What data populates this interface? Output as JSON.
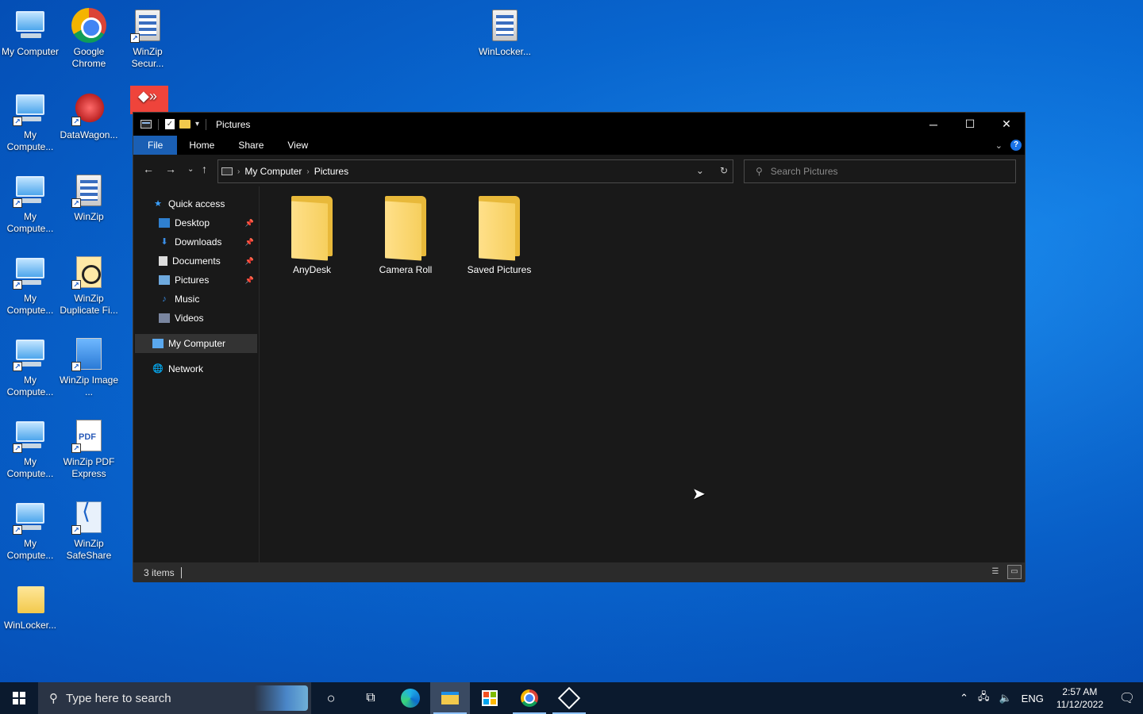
{
  "desktop": {
    "icons": [
      {
        "label": "My Computer",
        "type": "pc"
      },
      {
        "label": "Google Chrome",
        "type": "chrome"
      },
      {
        "label": "WinZip Secur...",
        "type": "zip"
      },
      {
        "label": "WinLocker...",
        "type": "zip"
      },
      {
        "label": "My Compute...",
        "type": "pc"
      },
      {
        "label": "DataWagon...",
        "type": "data"
      },
      {
        "label": "My Compute...",
        "type": "pc"
      },
      {
        "label": "WinZip",
        "type": "zip"
      },
      {
        "label": "My Compute...",
        "type": "pc"
      },
      {
        "label": "WinZip Duplicate Fi...",
        "type": "dup"
      },
      {
        "label": "My Compute...",
        "type": "pc"
      },
      {
        "label": "WinZip Image ...",
        "type": "image"
      },
      {
        "label": "My Compute...",
        "type": "pc"
      },
      {
        "label": "WinZip PDF Express",
        "type": "pdf"
      },
      {
        "label": "My Compute...",
        "type": "pc"
      },
      {
        "label": "WinZip SafeShare",
        "type": "share"
      },
      {
        "label": "WinLocker...",
        "type": "folder"
      }
    ]
  },
  "explorer": {
    "title": "Pictures",
    "ribbon_tabs": [
      "File",
      "Home",
      "Share",
      "View"
    ],
    "address": {
      "root": "My Computer",
      "current": "Pictures"
    },
    "search_placeholder": "Search Pictures",
    "nav": {
      "quick_access": "Quick access",
      "items": [
        {
          "label": "Desktop",
          "icon": "desktop-icon",
          "pinned": true
        },
        {
          "label": "Downloads",
          "icon": "download-icon",
          "pinned": true
        },
        {
          "label": "Documents",
          "icon": "documents-icon",
          "pinned": true
        },
        {
          "label": "Pictures",
          "icon": "pictures-icon",
          "pinned": true
        },
        {
          "label": "Music",
          "icon": "music-icon",
          "pinned": false
        },
        {
          "label": "Videos",
          "icon": "videos-icon",
          "pinned": false
        }
      ],
      "my_computer": "My Computer",
      "network": "Network"
    },
    "folders": [
      "AnyDesk",
      "Camera Roll",
      "Saved Pictures"
    ],
    "status": {
      "count": "3 items"
    }
  },
  "taskbar": {
    "search_placeholder": "Type here to search",
    "language": "ENG",
    "time": "2:57 AM",
    "date": "11/12/2022"
  }
}
